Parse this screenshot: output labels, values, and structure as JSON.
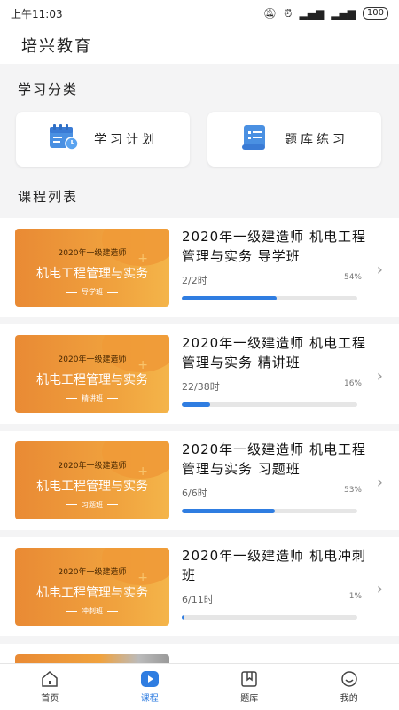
{
  "status_bar": {
    "time": "上午11:03",
    "battery": "100"
  },
  "header": {
    "title": "培兴教育"
  },
  "categories": {
    "title": "学习分类",
    "items": [
      {
        "label": "学习计划",
        "icon": "calendar-icon"
      },
      {
        "label": "题库练习",
        "icon": "scroll-list-icon"
      }
    ]
  },
  "course_list": {
    "title": "课程列表",
    "items": [
      {
        "thumb_year": "2020年一级建造师",
        "thumb_subject": "机电工程管理与实务",
        "thumb_class": "导学班",
        "title": "2020年一级建造师 机电工程管理与实务 导学班",
        "hours": "2/2时",
        "percent_label": "54%",
        "progress": 0.54
      },
      {
        "thumb_year": "2020年一级建造师",
        "thumb_subject": "机电工程管理与实务",
        "thumb_class": "精讲班",
        "title": "2020年一级建造师 机电工程管理与实务 精讲班",
        "hours": "22/38时",
        "percent_label": "16%",
        "progress": 0.16
      },
      {
        "thumb_year": "2020年一级建造师",
        "thumb_subject": "机电工程管理与实务",
        "thumb_class": "习题班",
        "title": "2020年一级建造师 机电工程管理与实务 习题班",
        "hours": "6/6时",
        "percent_label": "53%",
        "progress": 0.53
      },
      {
        "thumb_year": "2020年一级建造师",
        "thumb_subject": "机电工程管理与实务",
        "thumb_class": "冲刺班",
        "title": "2020年一级建造师 机电冲刺班",
        "hours": "6/11时",
        "percent_label": "1%",
        "progress": 0.01
      }
    ]
  },
  "tabbar": {
    "items": [
      {
        "label": "首页",
        "icon": "home-icon",
        "active": false
      },
      {
        "label": "课程",
        "icon": "play-icon",
        "active": true
      },
      {
        "label": "题库",
        "icon": "bookmark-book-icon",
        "active": false
      },
      {
        "label": "我的",
        "icon": "user-face-icon",
        "active": false
      }
    ]
  },
  "colors": {
    "accent": "#2f7de1",
    "thumb_orange": "#ef9a37"
  }
}
